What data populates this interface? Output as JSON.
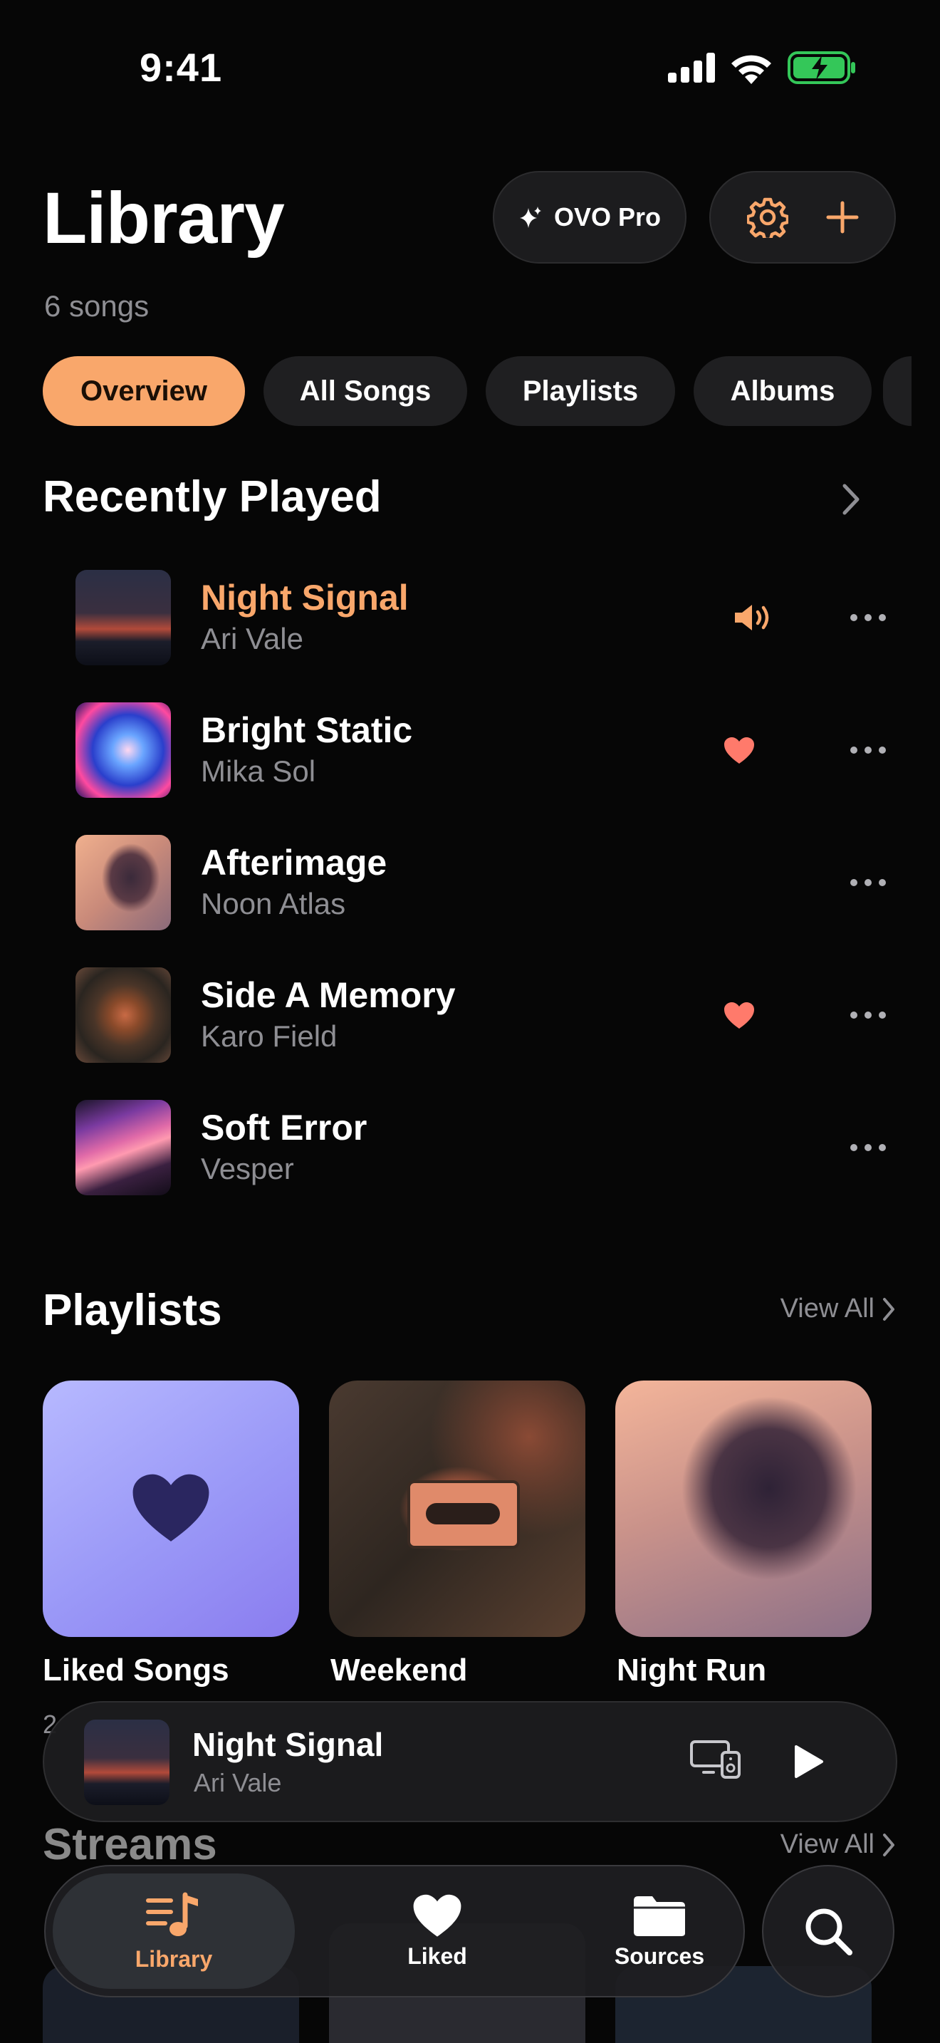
{
  "status_bar": {
    "time": "9:41"
  },
  "header": {
    "title": "Library",
    "subtitle": "6 songs",
    "pro_label": "OVO Pro"
  },
  "tabs": [
    {
      "label": "Overview",
      "active": true
    },
    {
      "label": "All Songs",
      "active": false
    },
    {
      "label": "Playlists",
      "active": false
    },
    {
      "label": "Albums",
      "active": false
    }
  ],
  "recently_played": {
    "title": "Recently Played",
    "songs": [
      {
        "title": "Night Signal",
        "artist": "Ari Vale",
        "status": "playing",
        "art": "city-night"
      },
      {
        "title": "Bright Static",
        "artist": "Mika Sol",
        "status": "liked",
        "art": "neon-device"
      },
      {
        "title": "Afterimage",
        "artist": "Noon Atlas",
        "status": "none",
        "art": "blurred-portrait"
      },
      {
        "title": "Side A Memory",
        "artist": "Karo Field",
        "status": "liked",
        "art": "cassette"
      },
      {
        "title": "Soft Error",
        "artist": "Vesper",
        "status": "none",
        "art": "sunset-window"
      }
    ]
  },
  "playlists": {
    "title": "Playlists",
    "view_all": "View All",
    "items": [
      {
        "name": "Liked Songs",
        "count_prefix": "2"
      },
      {
        "name": "Weekend"
      },
      {
        "name": "Night Run"
      }
    ]
  },
  "streams": {
    "title": "Streams",
    "view_all": "View All"
  },
  "now_playing": {
    "title": "Night Signal",
    "artist": "Ari Vale"
  },
  "tab_bar": [
    {
      "label": "Library",
      "active": true
    },
    {
      "label": "Liked",
      "active": false
    },
    {
      "label": "Sources",
      "active": false
    }
  ],
  "colors": {
    "accent": "#f9a76b",
    "heart": "#ff7a6b",
    "background": "#060606",
    "battery": "#34c759"
  }
}
